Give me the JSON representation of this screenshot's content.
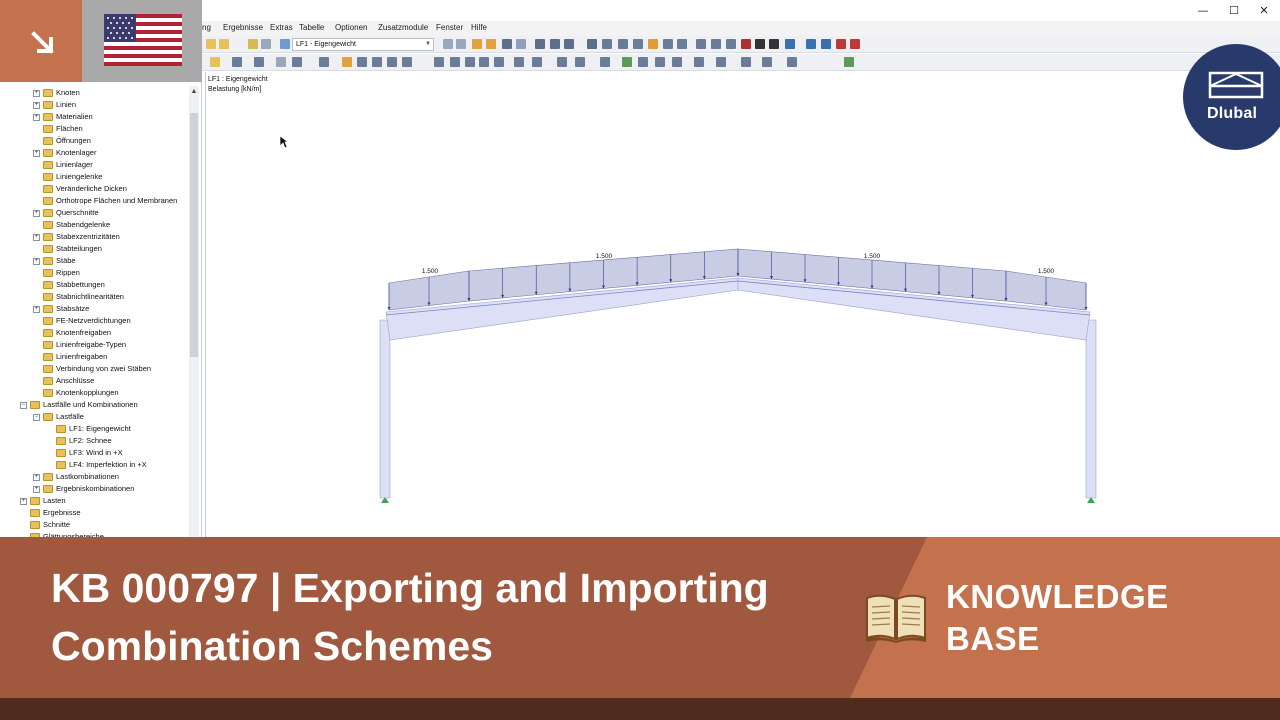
{
  "menu": [
    "ng",
    "Ergebnisse",
    "Extras",
    "Tabelle",
    "Optionen",
    "Zusatzmodule",
    "Fenster",
    "Hilfe"
  ],
  "window_controls": [
    "—",
    "☐",
    "✕"
  ],
  "toolbar": {
    "load_case_select": "LF1 - Eigengewicht"
  },
  "navigator": {
    "items": [
      {
        "label": "Knoten",
        "expandable": true
      },
      {
        "label": "Linien",
        "expandable": true
      },
      {
        "label": "Materialien",
        "expandable": true
      },
      {
        "label": "Flächen",
        "expandable": false
      },
      {
        "label": "Öffnungen",
        "expandable": false
      },
      {
        "label": "Knotenlager",
        "expandable": true
      },
      {
        "label": "Linienlager",
        "expandable": false
      },
      {
        "label": "Liniengelenke",
        "expandable": false
      },
      {
        "label": "Veränderliche Dicken",
        "expandable": false
      },
      {
        "label": "Orthotrope Flächen und Membranen",
        "expandable": false
      },
      {
        "label": "Querschnitte",
        "expandable": true
      },
      {
        "label": "Stabendgelenke",
        "expandable": false
      },
      {
        "label": "Stabexzentrizitäten",
        "expandable": true
      },
      {
        "label": "Stabteilungen",
        "expandable": false
      },
      {
        "label": "Stäbe",
        "expandable": true
      },
      {
        "label": "Rippen",
        "expandable": false
      },
      {
        "label": "Stabbettungen",
        "expandable": false
      },
      {
        "label": "Stabnichtlinearitäten",
        "expandable": false
      },
      {
        "label": "Stabsätze",
        "expandable": true
      },
      {
        "label": "FE-Netzverdichtungen",
        "expandable": false
      },
      {
        "label": "Knotenfreigaben",
        "expandable": false
      },
      {
        "label": "Linienfreigabe-Typen",
        "expandable": false
      },
      {
        "label": "Linienfreigaben",
        "expandable": false
      },
      {
        "label": "Verbindung von zwei Stäben",
        "expandable": false
      },
      {
        "label": "Anschlüsse",
        "expandable": false
      },
      {
        "label": "Knotenkopplungen",
        "expandable": false
      }
    ],
    "group": "Lastfälle und Kombinationen",
    "lastfaelle": "Lastfälle",
    "load_cases": [
      "LF1: Eigengewicht",
      "LF2: Schnee",
      "LF3: Wind in +X",
      "LF4: Imperfektion in +X"
    ],
    "combos": [
      "Lastkombinationen",
      "Ergebniskombinationen"
    ],
    "root_items": [
      "Lasten",
      "Ergebnisse",
      "Schnitte",
      "Glättungsbereiche"
    ]
  },
  "view": {
    "load_case": "LF1 : Eigengewicht",
    "load_unit": "Belastung [kN/m]",
    "load_labels": [
      "1.500",
      "1.500",
      "1.500",
      "1.500"
    ]
  },
  "logo": "Dlubal",
  "banner": {
    "title_line1": "KB 000797 | Exporting and Importing",
    "title_line2": "Combination Schemes",
    "kb_line1": "KNOWLEDGE",
    "kb_line2": "BASE"
  },
  "colors": {
    "banner_dark": "#a0583f",
    "banner_light": "#c4714d",
    "footer": "#4f2a1f",
    "logo_bg": "#283a6c",
    "load_fill": "#c9cde3",
    "member_fill": "#dcdff5"
  }
}
